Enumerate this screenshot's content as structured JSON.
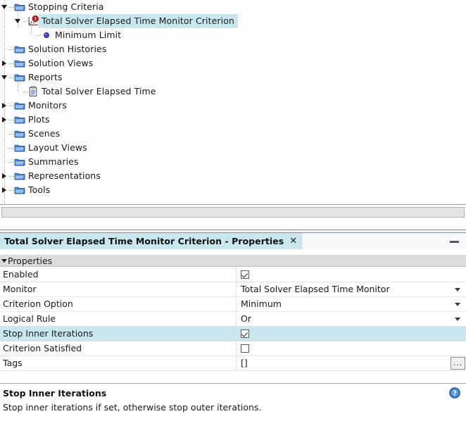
{
  "tree": {
    "items": [
      {
        "label": "Stopping Criteria",
        "depth": 0,
        "twisty": "expanded",
        "icon": "folder-icon",
        "selected": false
      },
      {
        "label": "Total Solver Elapsed Time Monitor Criterion",
        "depth": 1,
        "twisty": "expanded",
        "icon": "monitor-criterion-icon",
        "selected": true
      },
      {
        "label": "Minimum Limit",
        "depth": 2,
        "twisty": "none",
        "icon": "blue-dot-icon",
        "selected": false
      },
      {
        "label": "Solution Histories",
        "depth": 0,
        "twisty": "none",
        "icon": "folder-icon",
        "selected": false
      },
      {
        "label": "Solution Views",
        "depth": 0,
        "twisty": "collapsed",
        "icon": "folder-icon",
        "selected": false
      },
      {
        "label": "Reports",
        "depth": 0,
        "twisty": "expanded",
        "icon": "folder-icon",
        "selected": false
      },
      {
        "label": "Total Solver Elapsed Time",
        "depth": 1,
        "twisty": "none",
        "icon": "report-icon",
        "selected": false
      },
      {
        "label": "Monitors",
        "depth": 0,
        "twisty": "collapsed",
        "icon": "folder-icon",
        "selected": false
      },
      {
        "label": "Plots",
        "depth": 0,
        "twisty": "collapsed",
        "icon": "folder-icon",
        "selected": false
      },
      {
        "label": "Scenes",
        "depth": 0,
        "twisty": "none",
        "icon": "folder-icon",
        "selected": false
      },
      {
        "label": "Layout Views",
        "depth": 0,
        "twisty": "none",
        "icon": "folder-icon",
        "selected": false
      },
      {
        "label": "Summaries",
        "depth": 0,
        "twisty": "none",
        "icon": "folder-icon",
        "selected": false
      },
      {
        "label": "Representations",
        "depth": 0,
        "twisty": "collapsed",
        "icon": "folder-icon",
        "selected": false
      },
      {
        "label": "Tools",
        "depth": 0,
        "twisty": "collapsed",
        "icon": "folder-icon",
        "selected": false
      }
    ]
  },
  "properties_window": {
    "tab_title": "Total Solver Elapsed Time Monitor Criterion - Properties",
    "close_label": "✕",
    "section_label": "Properties",
    "rows": [
      {
        "name": "Enabled",
        "kind": "checkbox",
        "checked": true,
        "value": "",
        "highlight": false
      },
      {
        "name": "Monitor",
        "kind": "dropdown",
        "checked": false,
        "value": "Total Solver Elapsed Time Monitor",
        "highlight": false
      },
      {
        "name": "Criterion Option",
        "kind": "dropdown",
        "checked": false,
        "value": "Minimum",
        "highlight": false
      },
      {
        "name": "Logical Rule",
        "kind": "dropdown",
        "checked": false,
        "value": "Or",
        "highlight": false
      },
      {
        "name": "Stop Inner Iterations",
        "kind": "checkbox",
        "checked": true,
        "value": "",
        "highlight": true
      },
      {
        "name": "Criterion Satisfied",
        "kind": "checkbox",
        "checked": false,
        "value": "",
        "highlight": false
      },
      {
        "name": "Tags",
        "kind": "editor",
        "checked": false,
        "value": "[]",
        "highlight": false,
        "button_label": "..."
      }
    ]
  },
  "help_pane": {
    "title": "Stop Inner Iterations",
    "description": "Stop inner iterations if set, otherwise stop outer iterations."
  },
  "colors": {
    "selection": "#c9e7ee",
    "folder": "#4a7ebb",
    "accent_red": "#cc2222",
    "help_blue": "#2f6fc0"
  }
}
